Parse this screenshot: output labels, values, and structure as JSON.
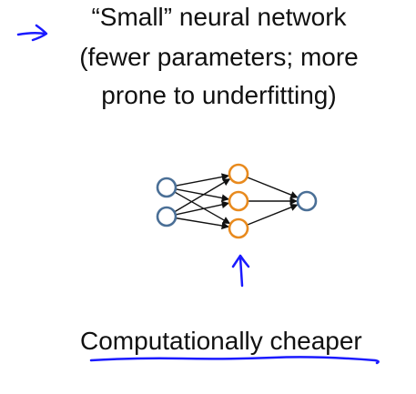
{
  "slide": {
    "title_line_1": "“Small” neural network",
    "title_line_2": "(fewer parameters; more",
    "title_line_3": "prone to underfitting)",
    "caption": "Computationally cheaper"
  },
  "network": {
    "input_nodes": 2,
    "hidden_nodes": 3,
    "output_nodes": 1
  },
  "colors": {
    "input_node": "#4a6f96",
    "hidden_node": "#e88a1e",
    "output_node": "#4a6f96",
    "annotation_ink": "#1a1aff",
    "edge": "#111111"
  }
}
